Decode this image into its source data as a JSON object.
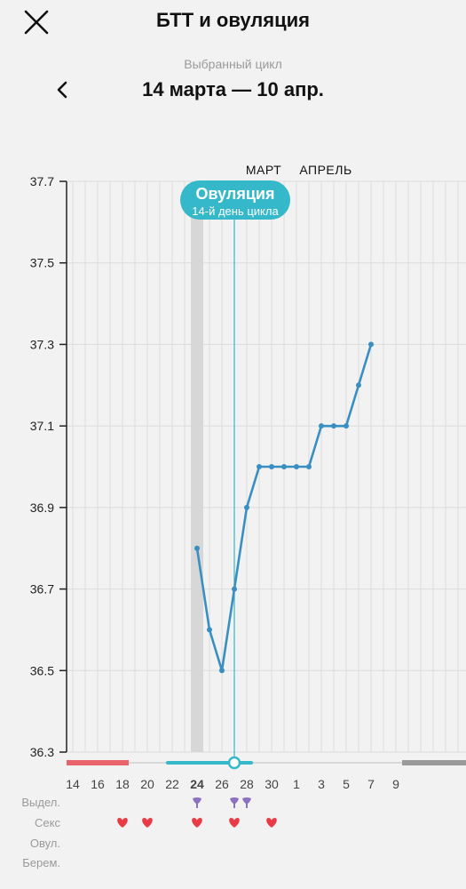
{
  "header": {
    "title": "БТТ и овуляция",
    "close_icon": "close-icon",
    "subtitle": "Выбранный цикл",
    "cycle_range": "14 марта — 10 апр.",
    "back_icon": "chevron-left-icon"
  },
  "colors": {
    "line": "#3a8fc2",
    "accent": "#35b8c9",
    "period": "#e8636a",
    "heart": "#e83b45",
    "discharge": "#8a72c0",
    "shade": "#d7d7d7",
    "grid": "#dcdcdc"
  },
  "ovulation": {
    "title": "Овуляция",
    "subtitle": "14-й день цикла"
  },
  "months": [
    "МАРТ",
    "АПРЕЛЬ"
  ],
  "rows": {
    "discharge": "Выдел.",
    "sex": "Секс",
    "ovulation": "Овул.",
    "pregnancy": "Берем."
  },
  "chart_data": {
    "type": "line",
    "title": "",
    "xlabel": "",
    "ylabel": "",
    "y_ticks": [
      "37.7",
      "37.5",
      "37.3",
      "37.1",
      "36.9",
      "36.7",
      "36.5",
      "36.3"
    ],
    "ylim": [
      36.3,
      37.7
    ],
    "x_ticks": [
      "14",
      "16",
      "18",
      "20",
      "22",
      "24",
      "26",
      "28",
      "30",
      "1",
      "3",
      "5",
      "7",
      "9"
    ],
    "current_day_label": "24",
    "grid": true,
    "series": [
      {
        "x": [
          "24",
          "25",
          "26",
          "27",
          "28",
          "29",
          "30",
          "31",
          "1",
          "2",
          "3",
          "4",
          "5",
          "6",
          "7"
        ],
        "values": [
          36.8,
          36.6,
          36.5,
          36.7,
          36.9,
          37.0,
          37.0,
          37.0,
          37.0,
          37.0,
          37.1,
          37.1,
          37.1,
          37.2,
          37.3
        ]
      }
    ],
    "ovulation_day": "27",
    "shaded_day": "24",
    "sex_days": [
      "18",
      "20",
      "24",
      "27",
      "30"
    ],
    "discharge_days": [
      "24",
      "27",
      "28"
    ]
  }
}
